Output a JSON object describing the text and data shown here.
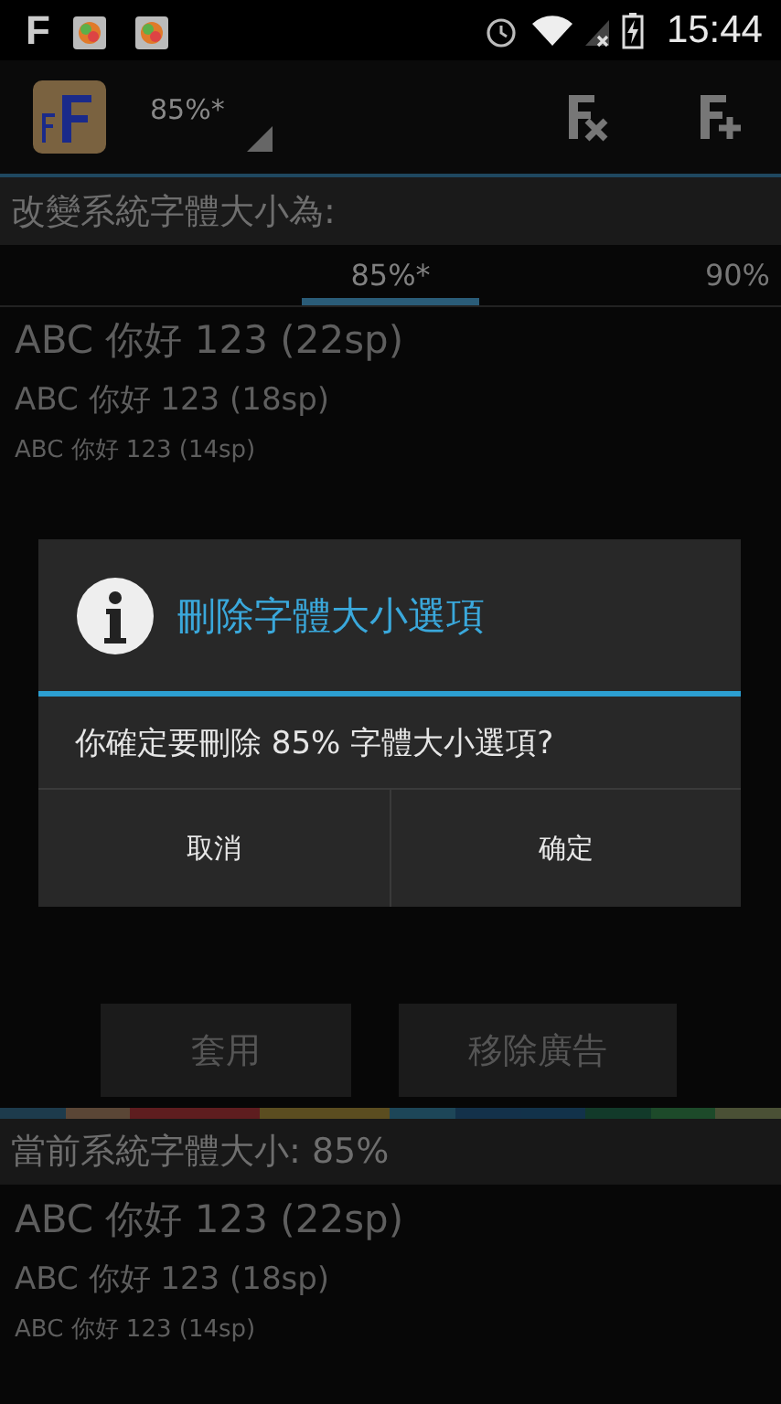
{
  "status_bar": {
    "app_letter": "F",
    "time": "15:44"
  },
  "action_bar": {
    "spinner_value": "85%*"
  },
  "change_section": {
    "heading": "改變系統字體大小為:",
    "tabs": [
      {
        "label": "85%*",
        "selected": true
      },
      {
        "label": "90%",
        "selected": false
      }
    ],
    "samples": [
      {
        "text": "ABC 你好 123 (22sp)",
        "kind": "large"
      },
      {
        "text": "ABC 你好 123 (18sp)",
        "kind": "medium"
      },
      {
        "text": "ABC 你好 123 (14sp)",
        "kind": "small"
      }
    ]
  },
  "buttons": [
    "套用",
    "移除廣告"
  ],
  "current_section": {
    "heading": "當前系統字體大小: 85%",
    "samples": [
      {
        "text": "ABC 你好 123 (22sp)",
        "kind": "large"
      },
      {
        "text": "ABC 你好 123 (18sp)",
        "kind": "medium"
      },
      {
        "text": "ABC 你好 123 (14sp)",
        "kind": "small"
      }
    ]
  },
  "dialog": {
    "title": "刪除字體大小選項",
    "message": "你確定要刪除 85% 字體大小選項?",
    "buttons": [
      "取消",
      "确定"
    ]
  }
}
